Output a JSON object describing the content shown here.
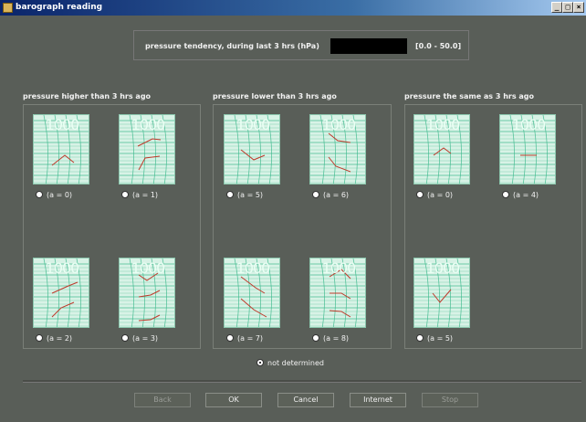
{
  "window": {
    "title": "barograph reading"
  },
  "tendency": {
    "label": "pressure tendency, during last 3 hrs (hPa)",
    "value": "",
    "range": "[0.0 - 50.0]"
  },
  "groups": [
    {
      "title": "pressure higher than 3 hrs ago"
    },
    {
      "title": "pressure lower than 3 hrs ago"
    },
    {
      "title": "pressure the same as 3 hrs ago"
    }
  ],
  "graph_label": "1000",
  "options": [
    {
      "label": "(a = 0)"
    },
    {
      "label": "(a = 1)"
    },
    {
      "label": "(a = 2)"
    },
    {
      "label": "(a = 3)"
    },
    {
      "label": "(a = 5)"
    },
    {
      "label": "(a = 6)"
    },
    {
      "label": "(a = 7)"
    },
    {
      "label": "(a = 8)"
    },
    {
      "label": "(a = 0)"
    },
    {
      "label": "(a = 4)"
    },
    {
      "label": "(a = 5)"
    }
  ],
  "not_determined": {
    "label": "not determined",
    "selected": true
  },
  "buttons": {
    "back": "Back",
    "ok": "OK",
    "cancel": "Cancel",
    "internet": "Internet",
    "stop": "Stop"
  },
  "colors": {
    "background": "#595e58",
    "graph_paper": "#d8f2e6",
    "trace": "#c0392b",
    "grid": "#3cb98c"
  }
}
